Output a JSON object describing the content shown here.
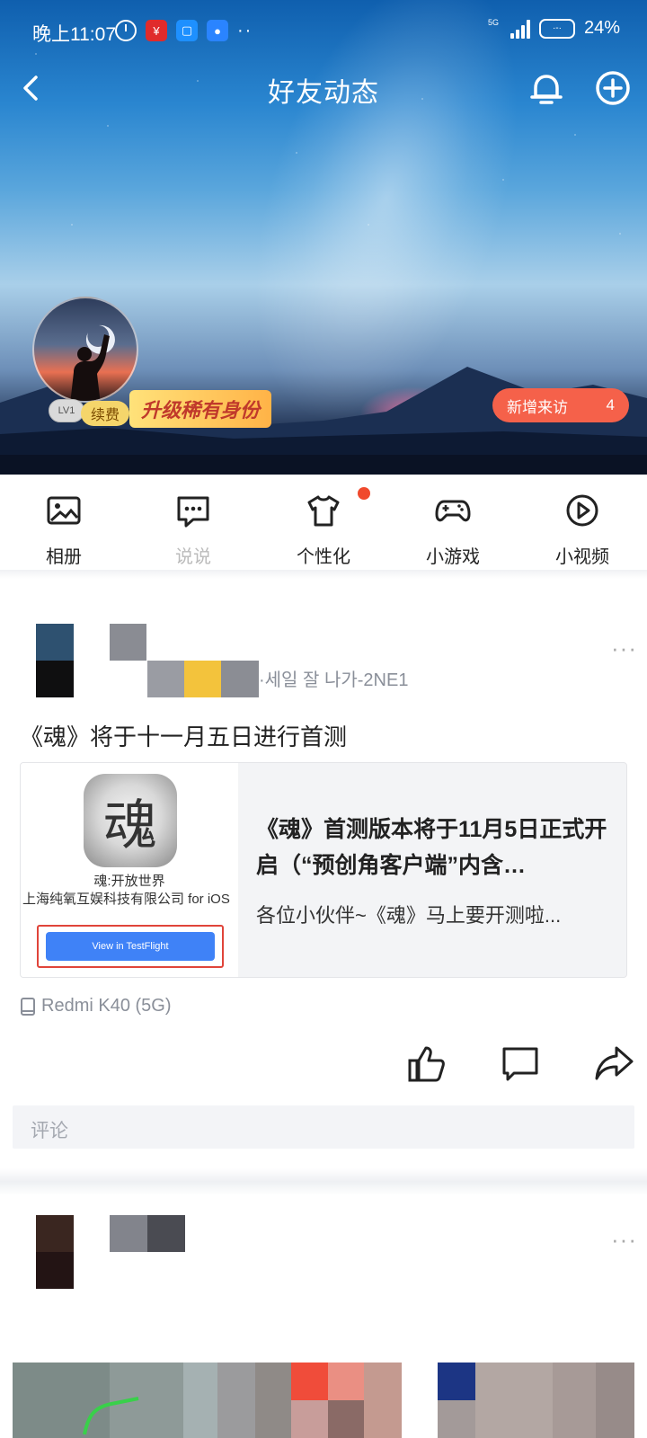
{
  "status_bar": {
    "time": "晚上11:07",
    "net": "5G",
    "battery_pct": "24%",
    "battery_face": "·-·"
  },
  "nav": {
    "title": "好友动态"
  },
  "profile": {
    "level": "LV1",
    "renew": "续费",
    "upgrade": "升级稀有身份",
    "visits_label": "新增来访",
    "visits_count": "4"
  },
  "shortcuts": [
    {
      "label": "相册",
      "icon": "photo-album-icon"
    },
    {
      "label": "说说",
      "icon": "chat-bubble-icon"
    },
    {
      "label": "个性化",
      "icon": "t-shirt-icon"
    },
    {
      "label": "小游戏",
      "icon": "gamepad-icon"
    },
    {
      "label": "小视频",
      "icon": "play-circle-icon"
    }
  ],
  "post1": {
    "song_line": "·세일 잘 나가-2NE1",
    "text": "《魂》将于十一月五日进行首测",
    "card": {
      "app_char": "魂",
      "app_name": "魂:开放世界",
      "app_company": "上海纯氧互娱科技有限公司 for iOS",
      "testflight_button": "View in TestFlight",
      "title": "《魂》首测版本将于11月5日正式开启（“预创角客户端”内含…",
      "desc": "各位小伙伴~《魂》马上要开测啦..."
    },
    "device": "Redmi K40 (5G)",
    "more": "···"
  },
  "comment": {
    "placeholder": "评论"
  },
  "post2": {
    "more": "···"
  },
  "colors": {
    "accent_red": "#f5614a",
    "testflight_blue": "#3f82f7",
    "hero_sky": "#2a86d0"
  }
}
